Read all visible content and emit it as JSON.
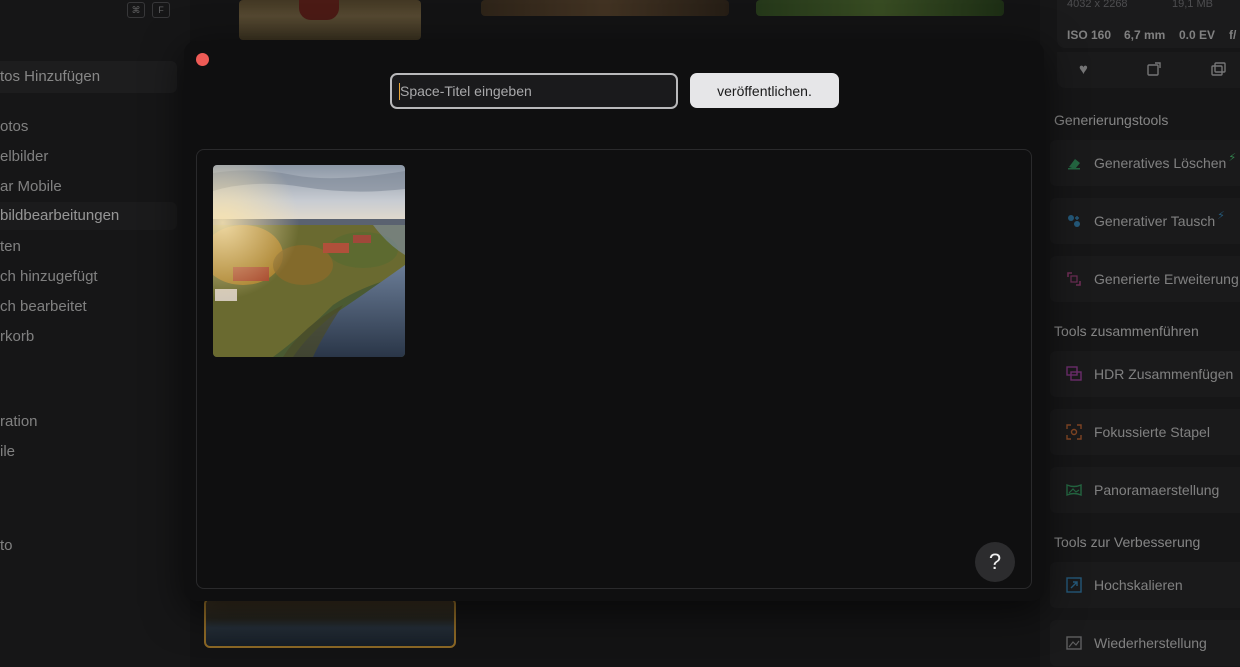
{
  "sidebar": {
    "shortcut_keys": [
      "⌘",
      "F"
    ],
    "add_photos": "tos Hinzufügen",
    "items": [
      {
        "label": "otos"
      },
      {
        "label": "elbilder"
      },
      {
        "label": "ar Mobile"
      },
      {
        "label": "bildbearbeitungen",
        "active": true
      },
      {
        "label": "ten"
      },
      {
        "label": "ch hinzugefügt"
      },
      {
        "label": "ch bearbeitet"
      },
      {
        "label": "rkorb"
      },
      {
        "label": "ration"
      },
      {
        "label": "ile"
      },
      {
        "label": "to"
      }
    ]
  },
  "info_panel": {
    "resolution": "4032 x 2268",
    "file_size": "19,1 MB",
    "iso": "ISO 160",
    "focal_length": "6,7 mm",
    "exposure": "0.0 EV",
    "aperture": "f/"
  },
  "tools": {
    "sections": [
      {
        "title": "Generierungstools",
        "items": [
          "Generatives Löschen",
          "Generativer Tausch",
          "Generierte Erweiterung"
        ]
      },
      {
        "title": "Tools zusammenführen",
        "items": [
          "HDR Zusammenfügen",
          "Fokussierte Stapel",
          "Panoramaerstellung"
        ]
      },
      {
        "title": "Tools zur Verbesserung",
        "items": [
          "Hochskalieren",
          "Wiederherstellung"
        ]
      }
    ]
  },
  "modal": {
    "title_placeholder": "Space-Titel eingeben",
    "title_value": "",
    "publish_label": "veröffentlichen.",
    "help_label": "?"
  },
  "colors": {
    "close_dot": "#ee5b56",
    "accent_orange": "#e0a63c",
    "bolt_green": "#4fd17a"
  }
}
